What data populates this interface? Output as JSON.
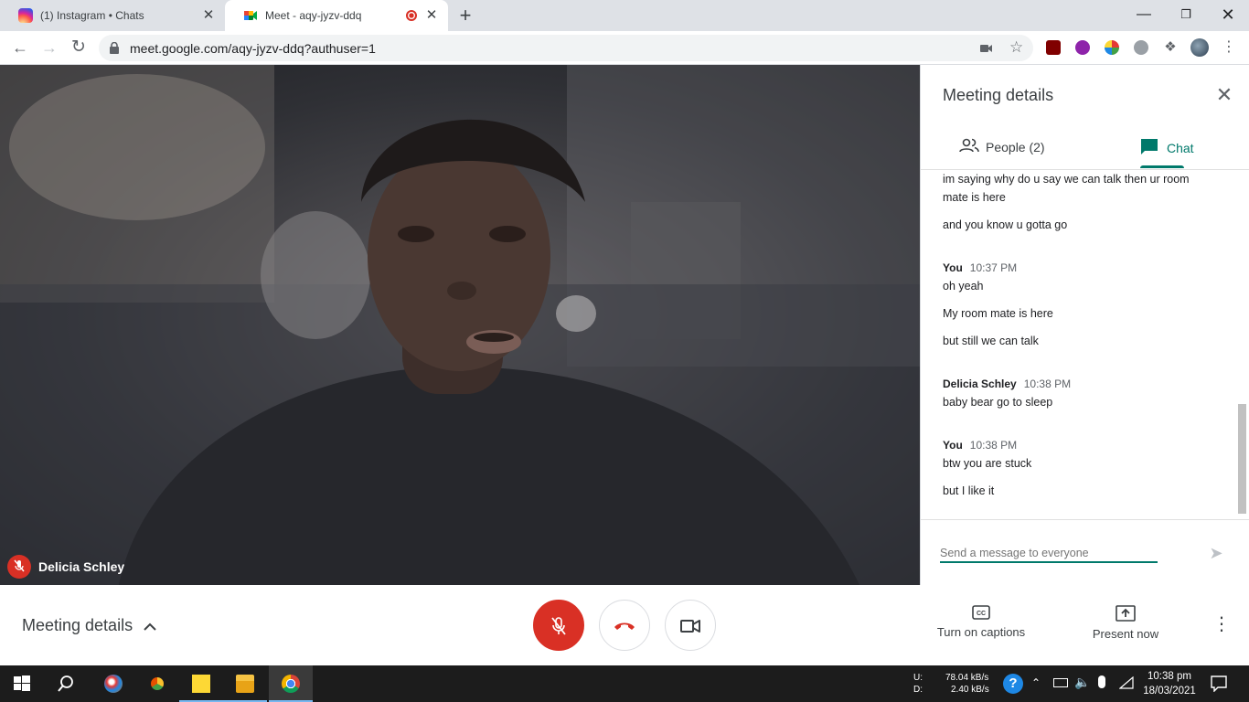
{
  "browser": {
    "tabs": [
      {
        "title": "(1) Instagram • Chats",
        "icon": "instagram-icon"
      },
      {
        "title": "Meet - aqy-jyzv-ddq",
        "icon": "google-meet-icon",
        "recording": true
      }
    ],
    "url": "meet.google.com/aqy-jyzv-ddq?authuser=1"
  },
  "video": {
    "speaker_name": "Delicia Schley"
  },
  "panel": {
    "title": "Meeting details",
    "tabs": {
      "people": "People (2)",
      "chat": "Chat"
    },
    "messages": [
      {
        "text": "im saying why do u say we can talk then ur room"
      },
      {
        "text": "mate is here"
      },
      {
        "text": "and you know u gotta go"
      },
      {
        "sender": "You",
        "time": "10:37 PM",
        "lines": [
          "oh yeah",
          "My room mate is here",
          "but still we can talk"
        ]
      },
      {
        "sender": "Delicia Schley",
        "time": "10:38 PM",
        "lines": [
          "baby bear  go to sleep"
        ]
      },
      {
        "sender": "You",
        "time": "10:38 PM",
        "lines": [
          "btw you are stuck",
          "but I like it"
        ]
      }
    ],
    "input_placeholder": "Send a message to everyone"
  },
  "controls": {
    "meeting_details": "Meeting details",
    "captions": "Turn on captions",
    "present": "Present now"
  },
  "taskbar": {
    "upload_label": "U:",
    "download_label": "D:",
    "upload_speed": "78.04 kB/s",
    "download_speed": "2.40 kB/s",
    "time": "10:38 pm",
    "date": "18/03/2021"
  },
  "colors": {
    "accent": "#00796b",
    "danger": "#d93025"
  }
}
